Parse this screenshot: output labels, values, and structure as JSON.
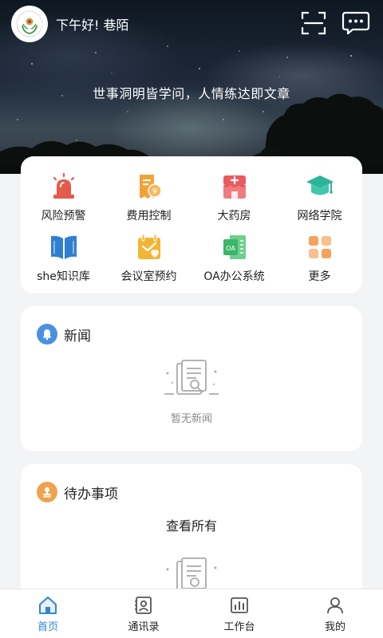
{
  "header": {
    "greeting": "下午好! 巷陌",
    "slogan": "世事洞明皆学问，人情练达即文章",
    "icons": [
      "logo-avatar",
      "scan-icon",
      "message-icon"
    ]
  },
  "quick_menu": {
    "items": [
      {
        "label": "风险预警",
        "icon": "alarm-light-icon",
        "color": "#e45b4c"
      },
      {
        "label": "费用控制",
        "icon": "fee-receipt-icon",
        "color": "#f2a23a"
      },
      {
        "label": "大药房",
        "icon": "pharmacy-icon",
        "color": "#e75a5f"
      },
      {
        "label": "网络学院",
        "icon": "graduation-cap-icon",
        "color": "#2cb59b"
      },
      {
        "label": "she知识库",
        "icon": "open-book-icon",
        "color": "#2f7fd1"
      },
      {
        "label": "会议室预约",
        "icon": "calendar-heart-icon",
        "color": "#f3b534"
      },
      {
        "label": "OA办公系统",
        "icon": "oa-office-icon",
        "color": "#3cb66a"
      },
      {
        "label": "更多",
        "icon": "more-grid-icon",
        "color": "#f5a25d"
      }
    ]
  },
  "news": {
    "title": "新闻",
    "empty_text": "暂无新闻",
    "badge_color": "#4a90e2"
  },
  "todo": {
    "title": "待办事项",
    "view_all": "查看所有",
    "badge_color": "#f0a24e"
  },
  "tabbar": {
    "active_color": "#2f86d6",
    "tabs": [
      {
        "label": "首页",
        "icon": "home-icon",
        "active": true
      },
      {
        "label": "通讯录",
        "icon": "contacts-icon",
        "active": false
      },
      {
        "label": "工作台",
        "icon": "workbench-chart-icon",
        "active": false
      },
      {
        "label": "我的",
        "icon": "profile-icon",
        "active": false
      }
    ]
  }
}
